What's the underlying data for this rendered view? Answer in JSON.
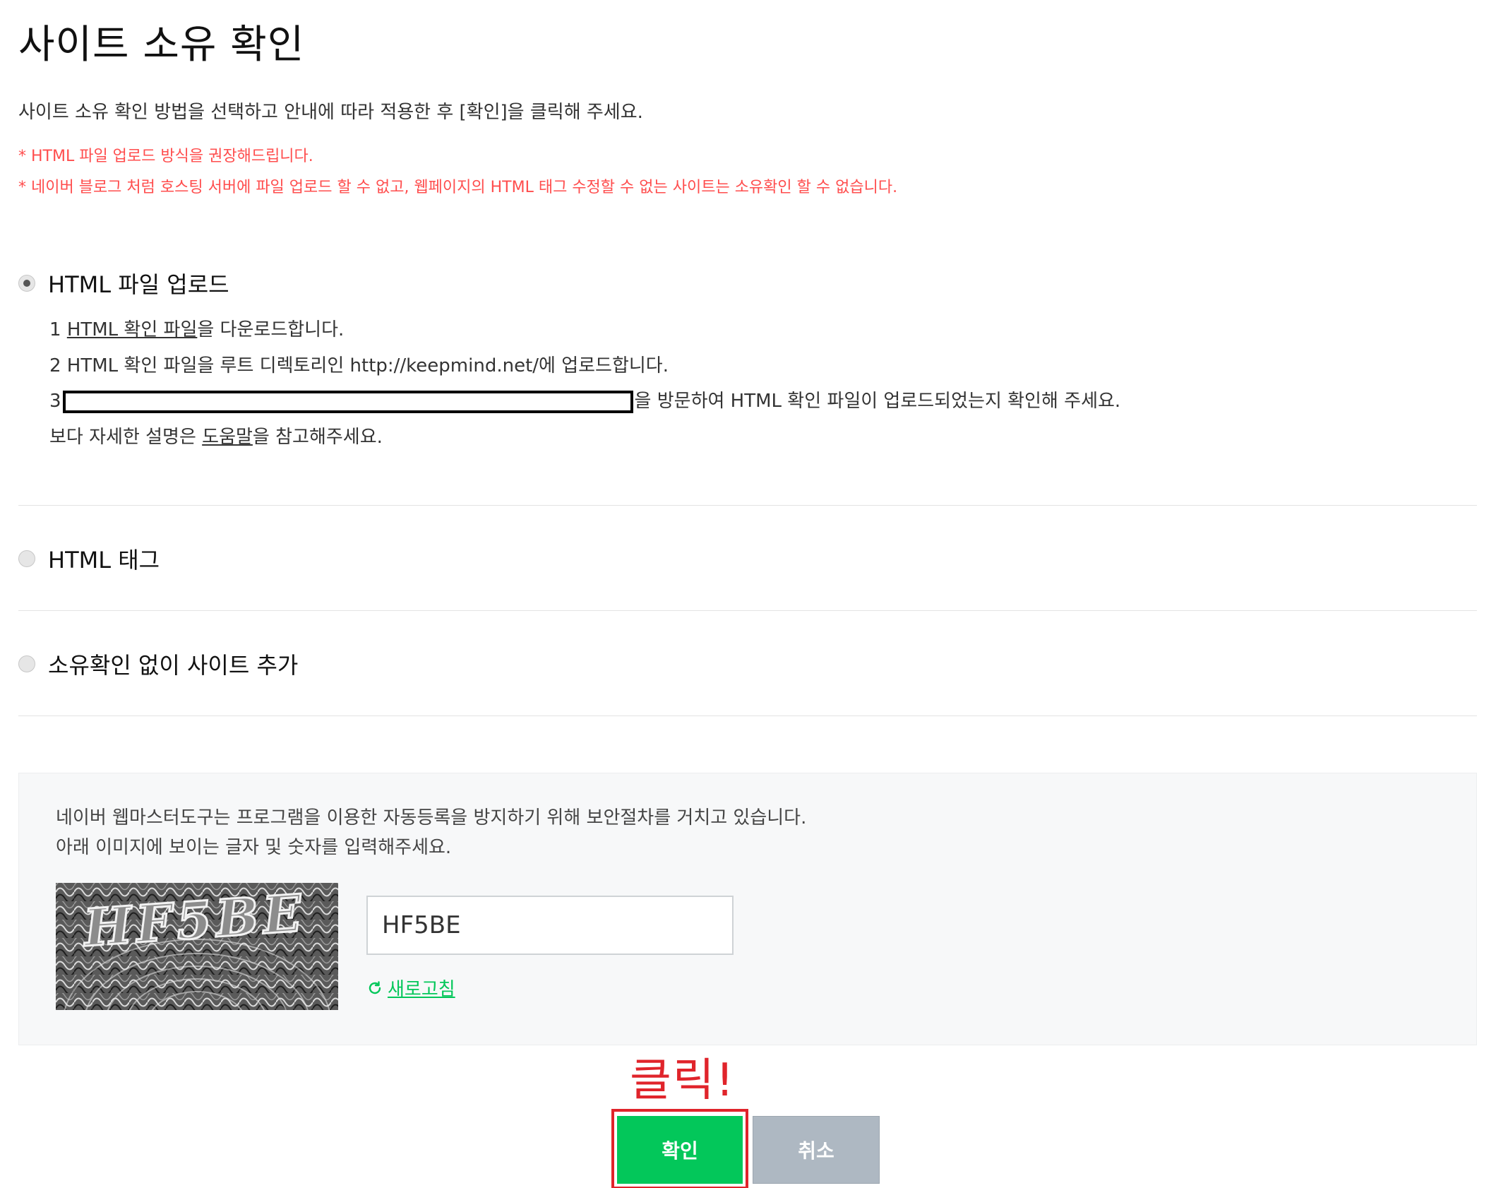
{
  "page": {
    "title": "사이트 소유 확인",
    "intro": "사이트 소유 확인 방법을 선택하고 안내에 따라 적용한 후 [확인]을 클릭해 주세요.",
    "notices": [
      "* HTML 파일 업로드 방식을 권장해드립니다.",
      "* 네이버 블로그 처럼 호스팅 서버에 파일 업로드 할 수 없고, 웹페이지의 HTML 태그 수정할 수 없는 사이트는 소유확인 할 수 없습니다."
    ]
  },
  "options": [
    {
      "label": "HTML 파일 업로드",
      "selected": true
    },
    {
      "label": "HTML 태그",
      "selected": false
    },
    {
      "label": "소유확인 없이 사이트 추가",
      "selected": false
    }
  ],
  "steps": {
    "step1": {
      "num": "1",
      "link": "HTML 확인 파일",
      "text": "을 다운로드합니다."
    },
    "step2": {
      "text": "2 HTML 확인 파일을 루트 디렉토리인 http://keepmind.net/에 업로드합니다."
    },
    "step3": {
      "num": "3",
      "text": "을 방문하여 HTML 확인 파일이 업로드되었는지 확인해 주세요."
    },
    "help": {
      "before": "보다 자세한 설명은 ",
      "link": "도움말",
      "after": "을 참고해주세요."
    }
  },
  "captcha": {
    "line1": "네이버 웹마스터도구는 프로그램을 이용한 자동등록을 방지하기 위해 보안절차를 거치고 있습니다.",
    "line2": "아래 이미지에 보이는 글자 및 숫자를 입력해주세요.",
    "image_text": "HF5BE",
    "input_value": "HF5BE",
    "refresh_label": "새로고침",
    "refresh_icon": "refresh-icon"
  },
  "annotation": {
    "callout": "클릭!",
    "color": "#e0242b"
  },
  "buttons": {
    "confirm": "확인",
    "cancel": "취소"
  },
  "colors": {
    "accent_green": "#03c75a",
    "notice_red": "#ff4d4d",
    "cancel_gray": "#aeb8c2"
  }
}
